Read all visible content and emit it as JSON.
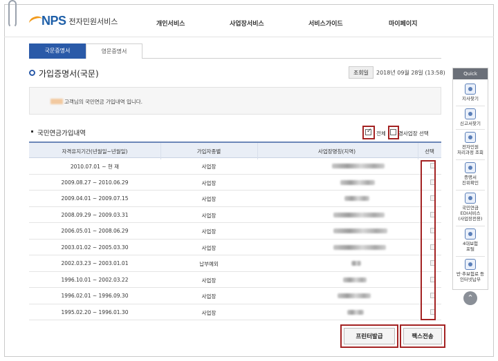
{
  "header": {
    "logo_brand": "NPS",
    "logo_service": "전자민원서비스",
    "nav": [
      "개인서비스",
      "사업장서비스",
      "서비스가이드",
      "마이페이지"
    ]
  },
  "tabs": [
    "국문증명서",
    "영문증명서"
  ],
  "page": {
    "title": "가입증명서(국문)",
    "query_label": "조회일",
    "query_date": "2018년 09월 28일 (13:58)"
  },
  "info": {
    "text": "고객님의 국민연금 가입내역 입니다."
  },
  "section": {
    "title": "국민연금가입내역",
    "check_all_label": "전체",
    "check_all_checked": true,
    "check_workplace_label": "경사업장 선택",
    "check_workplace_checked": false
  },
  "table": {
    "headers": [
      "자격유지기간(년월일~년월일)",
      "가입자종별",
      "사업장명칭(지역)",
      "선택"
    ],
    "rows": [
      {
        "period": "2010.07.01 ~ 현 재",
        "type": "사업장"
      },
      {
        "period": "2009.08.27 ~ 2010.06.29",
        "type": "사업장"
      },
      {
        "period": "2009.04.01 ~ 2009.07.15",
        "type": "사업장"
      },
      {
        "period": "2008.09.29 ~ 2009.03.31",
        "type": "사업장"
      },
      {
        "period": "2006.05.01 ~ 2008.06.29",
        "type": "사업장"
      },
      {
        "period": "2003.01.02 ~ 2005.03.30",
        "type": "사업장"
      },
      {
        "period": "2002.03.23 ~ 2003.01.01",
        "type": "납부예외"
      },
      {
        "period": "1996.10.01 ~ 2002.03.22",
        "type": "사업장"
      },
      {
        "period": "1996.02.01 ~ 1996.09.30",
        "type": "사업장"
      },
      {
        "period": "1995.02.20 ~ 1996.01.30",
        "type": "사업장"
      }
    ]
  },
  "buttons": {
    "print": "프린터발급",
    "fax": "팩스전송"
  },
  "quick": {
    "title": "Quick",
    "items": [
      {
        "label": "지사찾기",
        "icon": "map-icon"
      },
      {
        "label": "신고서찾기",
        "icon": "document-search-icon"
      },
      {
        "label": "전자민원\n처리과정 조회",
        "icon": "process-icon"
      },
      {
        "label": "증명서\n진위확인",
        "icon": "certificate-icon"
      },
      {
        "label": "국민연금\nEDI서비스\n(사업장전용)",
        "icon": "edi-icon"
      },
      {
        "label": "4대보험\n포털",
        "icon": "portal-icon"
      },
      {
        "label": "반·추보험료 등\n인터넷납부",
        "icon": "payment-icon"
      }
    ],
    "top_icon": "chevron-up-icon"
  },
  "colors": {
    "accent": "#2a5aa8",
    "highlight": "#a32121"
  }
}
